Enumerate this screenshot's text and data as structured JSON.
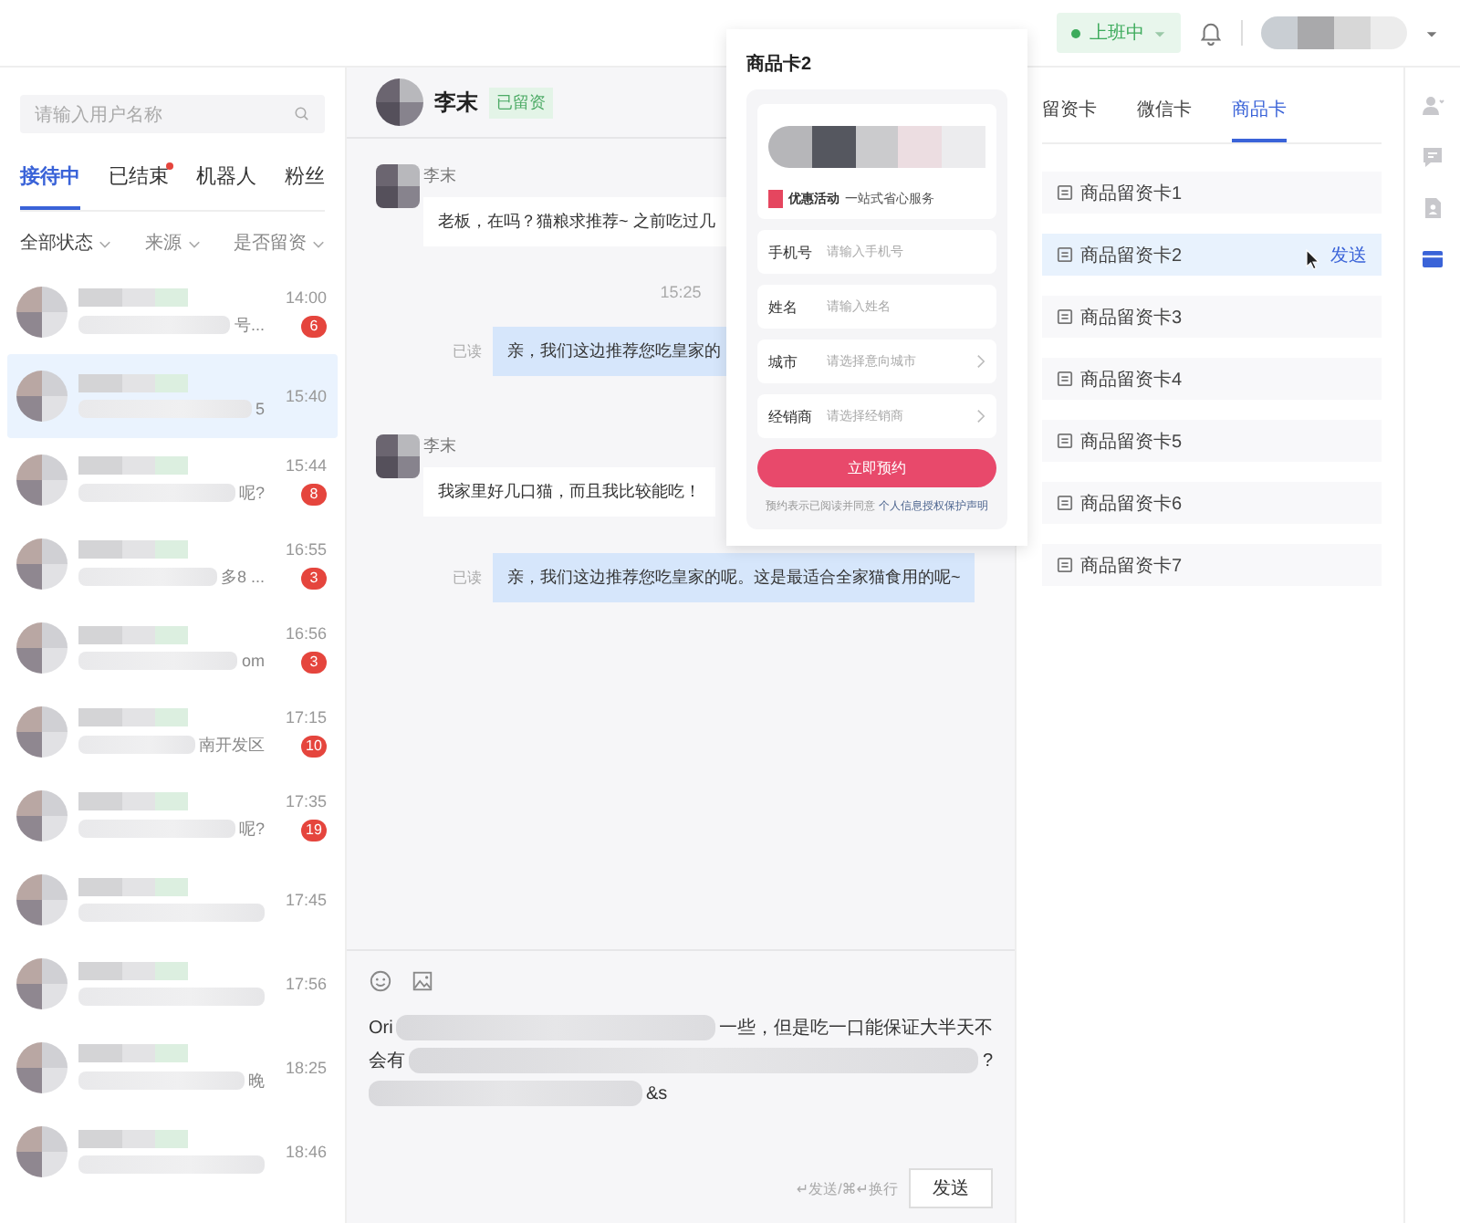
{
  "topbar": {
    "status": {
      "label": "上班中",
      "on": true
    }
  },
  "sidebar": {
    "search": {
      "placeholder": "请输入用户名称"
    },
    "tabs": [
      {
        "label": "接待中",
        "selected": true,
        "dot": false
      },
      {
        "label": "已结束",
        "selected": false,
        "dot": true
      },
      {
        "label": "机器人",
        "selected": false,
        "dot": false
      },
      {
        "label": "粉丝",
        "selected": false,
        "dot": false
      }
    ],
    "filters": [
      "全部状态",
      "来源",
      "是否留资"
    ],
    "conversations": [
      {
        "time": "14:00",
        "unread": "6",
        "snippet": "号...",
        "selected": false
      },
      {
        "time": "15:40",
        "snippet": "5",
        "selected": true
      },
      {
        "time": "15:44",
        "unread": "8",
        "snippet": "呢?",
        "selected": false
      },
      {
        "time": "16:55",
        "unread": "3",
        "snippet": "多8 ...",
        "selected": false
      },
      {
        "time": "16:56",
        "unread": "3",
        "snippet": "om",
        "selected": false
      },
      {
        "time": "17:15",
        "unread": "10",
        "snippet": "南开发区",
        "selected": false
      },
      {
        "time": "17:35",
        "unread": "19",
        "snippet": "呢?",
        "selected": false
      },
      {
        "time": "17:45",
        "selected": false
      },
      {
        "time": "17:56",
        "selected": false
      },
      {
        "time": "18:25",
        "snippet": "晚",
        "selected": false
      },
      {
        "time": "18:46",
        "selected": false
      }
    ]
  },
  "chat": {
    "name": "李末",
    "tag": "已留资",
    "messages": [
      {
        "kind": "incoming",
        "sender": "李末",
        "text": "老板，在吗？猫粮求推荐~ 之前吃过几"
      },
      {
        "kind": "time",
        "text": "15:25"
      },
      {
        "kind": "outgoing",
        "status": "已读",
        "text": "亲，我们这边推荐您吃皇家的"
      },
      {
        "kind": "incoming",
        "sender": "李末",
        "text": "我家里好几口猫，而且我比较能吃！"
      },
      {
        "kind": "outgoing",
        "status": "已读",
        "text": "亲，我们这边推荐您吃皇家的呢。这是最适合全家猫食用的呢~"
      }
    ],
    "composer": {
      "lines": [
        {
          "before": "Ori",
          "after": "一些，但是吃一口能保证大半天不"
        },
        {
          "before": "会有",
          "after": "?"
        },
        {
          "after": "&s"
        }
      ],
      "hint": "↵发送/⌘↵换行",
      "send": "发送"
    }
  },
  "product_card": {
    "title": "商品卡2",
    "promo_tag": "优惠活动",
    "promo_text": "一站式省心服务",
    "fields": [
      {
        "label": "手机号",
        "placeholder": "请输入手机号",
        "kind": "input"
      },
      {
        "label": "姓名",
        "placeholder": "请输入姓名",
        "kind": "input"
      },
      {
        "label": "城市",
        "placeholder": "请选择意向城市",
        "kind": "select"
      },
      {
        "label": "经销商",
        "placeholder": "请选择经销商",
        "kind": "select"
      }
    ],
    "button": "立即预约",
    "note": "预约表示已阅读并同意",
    "note_link": "个人信息授权保护声明"
  },
  "cards_panel": {
    "tabs": [
      {
        "label": "留资卡",
        "selected": false
      },
      {
        "label": "微信卡",
        "selected": false
      },
      {
        "label": "商品卡",
        "selected": true
      }
    ],
    "items": [
      {
        "label": "商品留资卡1",
        "hovered": false
      },
      {
        "label": "商品留资卡2",
        "hovered": true,
        "action": "发送"
      },
      {
        "label": "商品留资卡3",
        "hovered": false
      },
      {
        "label": "商品留资卡4",
        "hovered": false
      },
      {
        "label": "商品留资卡5",
        "hovered": false
      },
      {
        "label": "商品留资卡6",
        "hovered": false
      },
      {
        "label": "商品留资卡7",
        "hovered": false
      }
    ]
  },
  "rail": [
    {
      "kind": "user",
      "selected": false
    },
    {
      "kind": "chat",
      "selected": false
    },
    {
      "kind": "profile",
      "selected": false
    },
    {
      "kind": "card",
      "selected": true
    }
  ]
}
